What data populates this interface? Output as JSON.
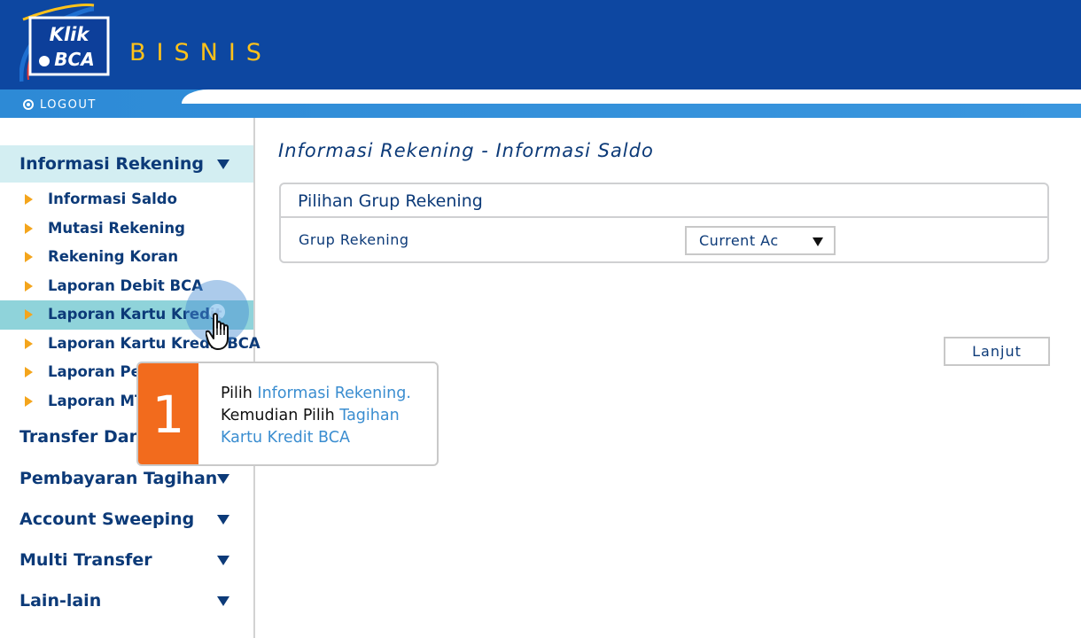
{
  "header": {
    "logo_line1": "Klik",
    "logo_line2": "BCA",
    "title": "BISNIS",
    "logout_label": "LOGOUT"
  },
  "sidebar": {
    "sections": [
      {
        "label": "Informasi Rekening",
        "active": true
      },
      {
        "label": "Transfer Dana"
      },
      {
        "label": "Pembayaran Tagihan"
      },
      {
        "label": "Account Sweeping"
      },
      {
        "label": "Multi Transfer"
      },
      {
        "label": "Lain-lain"
      }
    ],
    "sub_items": [
      "Informasi Saldo",
      "Mutasi Rekening",
      "Rekening Koran",
      "Laporan Debit BCA",
      "Laporan Kartu Kredit",
      "Laporan Kartu Kredit BCA",
      "Laporan Pe",
      "Laporan MT"
    ]
  },
  "main": {
    "page_title": "Informasi Rekening - Informasi Saldo",
    "panel_title": "Pilihan Grup Rekening",
    "field_label": "Grup Rekening",
    "select_value": "Current Ac",
    "submit_label": "Lanjut"
  },
  "callout": {
    "step": "1",
    "part1": "Pilih ",
    "part2": "Informasi Rekening.",
    "part3": "Kemudian Pilih ",
    "part4": "Tagihan Kartu Kredit BCA"
  },
  "colors": {
    "header_blue": "#0d47a1",
    "brand_yellow": "#ffc21a",
    "text_navy": "#0c3a78",
    "step_orange": "#f26b1d",
    "highlight_blue": "#3a8dd0"
  }
}
